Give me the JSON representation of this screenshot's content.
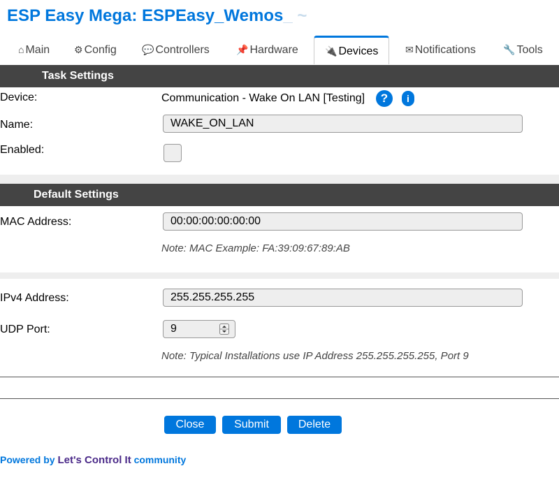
{
  "header": {
    "title": "ESP Easy Mega: ESPEasy_Wemos",
    "title_faded": "_ ~"
  },
  "tabs": [
    {
      "label": "Main",
      "icon": "home-icon",
      "glyph": "⌂"
    },
    {
      "label": "Config",
      "icon": "gear-icon",
      "glyph": "⚙"
    },
    {
      "label": "Controllers",
      "icon": "chat-icon",
      "glyph": "💬"
    },
    {
      "label": "Hardware",
      "icon": "pin-icon",
      "glyph": "📌"
    },
    {
      "label": "Devices",
      "icon": "plug-icon",
      "glyph": "🔌",
      "active": true
    },
    {
      "label": "Notifications",
      "icon": "envelope-icon",
      "glyph": "✉"
    },
    {
      "label": "Tools",
      "icon": "wrench-icon",
      "glyph": "🔧"
    }
  ],
  "task_settings": {
    "heading": "Task Settings",
    "device_label": "Device:",
    "device_value": "Communication - Wake On LAN [Testing]",
    "help_glyph": "?",
    "info_glyph": "i",
    "name_label": "Name:",
    "name_value": "WAKE_ON_LAN",
    "enabled_label": "Enabled:",
    "enabled": false
  },
  "default_settings": {
    "heading": "Default Settings",
    "mac_label": "MAC Address:",
    "mac_value": "00:00:00:00:00:00",
    "mac_note": "Note: MAC Example: FA:39:09:67:89:AB",
    "ip_label": "IPv4 Address:",
    "ip_value": "255.255.255.255",
    "port_label": "UDP Port:",
    "port_value": "9",
    "port_note": "Note: Typical Installations use IP Address 255.255.255.255, Port 9"
  },
  "buttons": {
    "close": "Close",
    "submit": "Submit",
    "delete": "Delete"
  },
  "footer": {
    "prefix": "Powered by ",
    "brand": "Let's Control It",
    "suffix": " community"
  },
  "colors": {
    "accent": "#0077dd",
    "section_bar": "#444444",
    "brand": "#4b2a89"
  }
}
